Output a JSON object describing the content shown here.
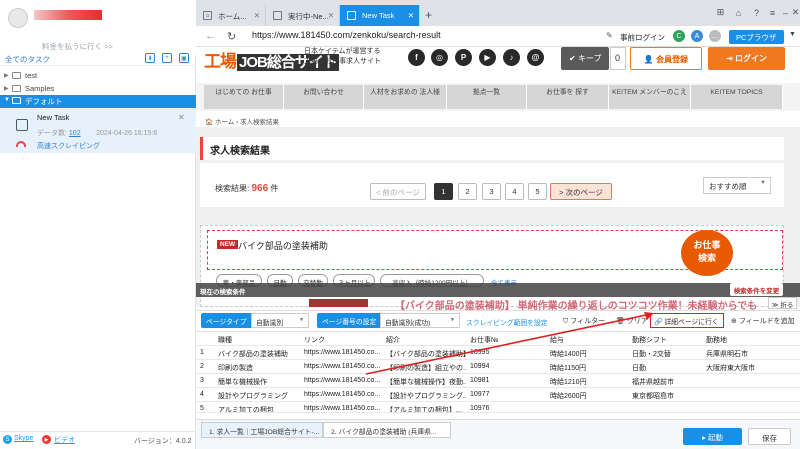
{
  "sidebar": {
    "pay_link": "料金を払うに行く >>",
    "tasks_title": "全てのタスク",
    "folders": [
      {
        "label": "test"
      },
      {
        "label": "Samples"
      },
      {
        "label": "デフォルト"
      }
    ],
    "task": {
      "name": "New Task",
      "data_label": "データ数:",
      "data_count": "102",
      "timestamp": "2024-04-26 16:15:6",
      "speed": "高速スクレイピング"
    },
    "footer": {
      "skype": "Skype",
      "video": "ビデオ",
      "version": "バージョン：4.0.2"
    }
  },
  "browser": {
    "tabs": [
      {
        "label": "ホーム..."
      },
      {
        "label": "実行中-Ne..."
      },
      {
        "label": "New Task"
      }
    ],
    "url": "https://www.181450.com/zenkoku/search-result",
    "pre_login": "事前ログイン",
    "pc_browser": "PCブラウザ"
  },
  "site": {
    "logo_a": "工場",
    "logo_b": "JOB総合サイト",
    "tagline": [
      "日本ケイテムが運営する",
      "工場のお仕事求人サイト"
    ],
    "social": [
      "f",
      "◎",
      "P",
      "▶",
      "♪",
      "@"
    ],
    "keep": "キープ",
    "keep_count": "0",
    "register": "会員登録",
    "login": "ログイン",
    "nav": [
      "はじめての お仕事",
      "お問い合わせ",
      "人材をお求めの 法人様",
      "拠点一覧",
      "お仕事を 探す",
      "KEITEM メンバーのこえ",
      "KEITEM TOPICS"
    ],
    "breadcrumb": "🏠 ホーム › 求人検索結果",
    "results_title": "求人検索結果",
    "count_label": "検索結果:",
    "count": "966",
    "count_unit": "件",
    "pager": {
      "prev": "< 前のページ",
      "pages": [
        "1",
        "2",
        "3",
        "4",
        "5"
      ],
      "next": "> 次のページ"
    },
    "sort": "おすすめ順",
    "job": {
      "badge": "NEW",
      "title": "バイク部品の塗装補助"
    },
    "chips": [
      "車・車部品",
      "日勤",
      "交替勤",
      "３ヶ月以上",
      "高収入（時給1200円以上）"
    ],
    "more": "全て表示",
    "bubble": [
      "お仕事",
      "検索"
    ],
    "cond_label": "現在の検索条件",
    "cond_change": "検索条件を変更",
    "hint": "【バイク部品の塗装補助】 単純作業の繰り返しのコツコツ作業！未経験からでも",
    "collapse": "折る"
  },
  "extract": {
    "page_type_label": "ページタイプ",
    "page_type_value": "自動識別",
    "page_num_label": "ページ番号の設定",
    "page_num_value": "自動識別(成功)",
    "scroll_link": "スクレイピング範囲を設定",
    "filter": "フィルター",
    "clear": "クリア",
    "goto_detail": "詳細ページに行く",
    "add_field": "フィールドを追加",
    "columns": [
      "職種",
      "リンク",
      "紹介",
      "お仕事№",
      "給与",
      "勤務シフト",
      "勤務地"
    ],
    "rows": [
      [
        "1",
        "バイク部品の塗装補助",
        "https://www.181450.co...",
        "【バイク部品の塗装補助】...",
        "10995",
        "時給1400円",
        "日勤・2交替",
        "兵庫県明石市"
      ],
      [
        "2",
        "印刷の製造",
        "https://www.181450.co...",
        "【印刷の製造】組立やの...",
        "10994",
        "時給1150円",
        "日勤",
        "大阪府東大阪市"
      ],
      [
        "3",
        "簡単な機械操作",
        "https://www.181450.co...",
        "【簡単な機械操作】夜勤...",
        "10981",
        "時給1210円",
        "福井県越前市",
        ""
      ],
      [
        "4",
        "設計やプログラミング",
        "https://www.181450.co...",
        "【設計やプログラミング...",
        "10977",
        "時給2600円",
        "東京都昭島市",
        ""
      ],
      [
        "5",
        "アルミ加工の梱包",
        "https://www.181450.co...",
        "【アルミ加工の梱包】...",
        "10976",
        "",
        "",
        ""
      ]
    ],
    "bottom_tabs": [
      "1. 求人一覧｜工場JOB総合サイト-...",
      "2. バイク部品の塗装補助 (兵庫県..."
    ],
    "start": "▸ 起動",
    "save": "保存"
  },
  "colors": {
    "accent": "#1a8fe6",
    "brand": "#e85a00",
    "highlight": "#e02020"
  }
}
